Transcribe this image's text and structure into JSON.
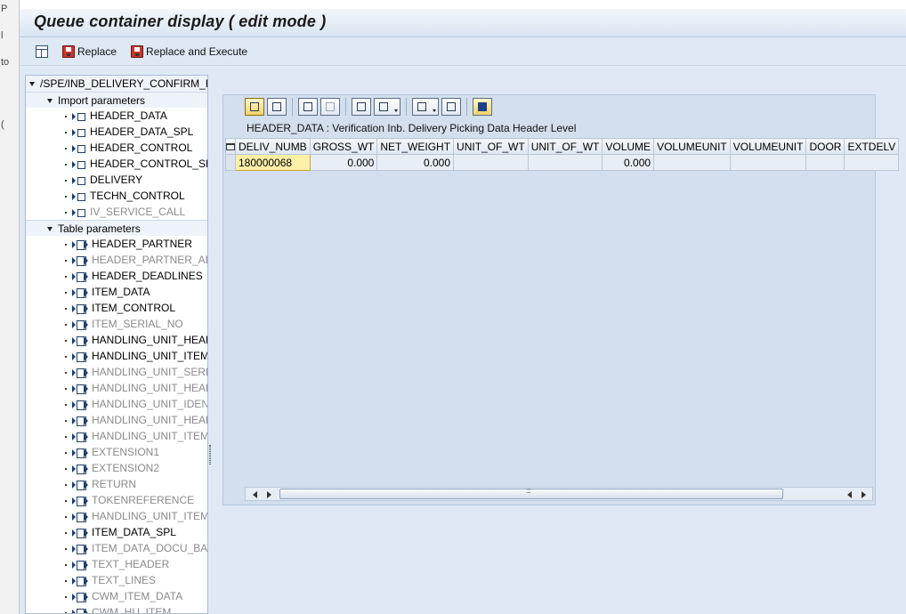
{
  "edge_chars": [
    "P",
    "l",
    "to",
    "("
  ],
  "window": {
    "title": "Queue container display ( edit mode )"
  },
  "toolbar": {
    "display_icon": "table-icon",
    "replace_label": "Replace",
    "replace_execute_label": "Replace and Execute"
  },
  "tree": {
    "root": "/SPE/INB_DELIVERY_CONFIRM_DEC",
    "import_label": "Import parameters",
    "import_items": [
      {
        "label": "HEADER_DATA",
        "grey": false
      },
      {
        "label": "HEADER_DATA_SPL",
        "grey": false
      },
      {
        "label": "HEADER_CONTROL",
        "grey": false
      },
      {
        "label": "HEADER_CONTROL_SPL",
        "grey": false
      },
      {
        "label": "DELIVERY",
        "grey": false
      },
      {
        "label": "TECHN_CONTROL",
        "grey": false
      },
      {
        "label": "IV_SERVICE_CALL",
        "grey": true
      }
    ],
    "table_label": "Table parameters",
    "table_items": [
      {
        "label": "HEADER_PARTNER",
        "grey": false
      },
      {
        "label": "HEADER_PARTNER_ADD",
        "grey": true
      },
      {
        "label": "HEADER_DEADLINES",
        "grey": false
      },
      {
        "label": "ITEM_DATA",
        "grey": false
      },
      {
        "label": "ITEM_CONTROL",
        "grey": false
      },
      {
        "label": "ITEM_SERIAL_NO",
        "grey": true
      },
      {
        "label": "HANDLING_UNIT_HEADER",
        "grey": false
      },
      {
        "label": "HANDLING_UNIT_ITEM",
        "grey": false
      },
      {
        "label": "HANDLING_UNIT_SERNO",
        "grey": true
      },
      {
        "label": "HANDLING_UNIT_HEAD",
        "grey": true
      },
      {
        "label": "HANDLING_UNIT_IDENT",
        "grey": true
      },
      {
        "label": "HANDLING_UNIT_HEAD",
        "grey": true
      },
      {
        "label": "HANDLING_UNIT_ITEMS",
        "grey": true
      },
      {
        "label": "EXTENSION1",
        "grey": true
      },
      {
        "label": "EXTENSION2",
        "grey": true
      },
      {
        "label": "RETURN",
        "grey": true
      },
      {
        "label": "TOKENREFERENCE",
        "grey": true
      },
      {
        "label": "HANDLING_UNIT_ITEM_",
        "grey": true
      },
      {
        "label": "ITEM_DATA_SPL",
        "grey": false
      },
      {
        "label": "ITEM_DATA_DOCU_BAT",
        "grey": true
      },
      {
        "label": "TEXT_HEADER",
        "grey": true
      },
      {
        "label": "TEXT_LINES",
        "grey": true
      },
      {
        "label": "CWM_ITEM_DATA",
        "grey": true
      },
      {
        "label": "CWM_HU_ITEM",
        "grey": true
      }
    ]
  },
  "grid": {
    "title": "HEADER_DATA : Verification Inb. Delivery Picking Data Header Level",
    "tool_icons": [
      "details-icon",
      "select-icon",
      "find-icon",
      "find-next-icon",
      "print-icon",
      "views-icon",
      "export-icon",
      "layout-icon",
      "info-icon"
    ],
    "columns": [
      "DELIV_NUMB",
      "GROSS_WT",
      "NET_WEIGHT",
      "UNIT_OF_WT",
      "UNIT_OF_WT",
      "VOLUME",
      "VOLUMEUNIT",
      "VOLUMEUNIT",
      "DOOR",
      "EXTDELV"
    ],
    "rows": [
      [
        "180000068",
        "0.000",
        "0.000",
        "",
        "",
        "0.000",
        "",
        "",
        "",
        ""
      ]
    ]
  },
  "colors": {
    "background": "#dfe9f5",
    "key_cell": "#fcefa6",
    "tree_grey": "#8a8a8a"
  }
}
